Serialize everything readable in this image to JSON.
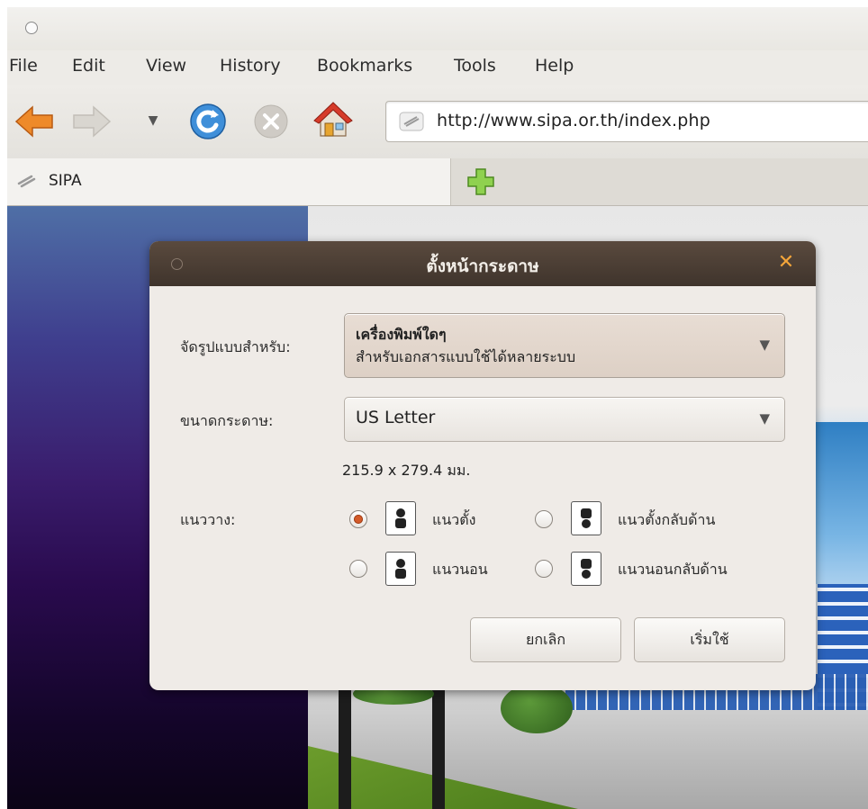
{
  "menubar": {
    "items": [
      "File",
      "Edit",
      "View",
      "History",
      "Bookmarks",
      "Tools",
      "Help"
    ]
  },
  "navbar": {
    "url": "http://www.sipa.or.th/index.php"
  },
  "tabs": [
    {
      "label": "SIPA"
    }
  ],
  "dialog": {
    "title": "ตั้งหน้ากระดาษ",
    "format_for_label": "จัดรูปแบบสำหรับ:",
    "printer_name": "เครื่องพิมพ์ใดๆ",
    "printer_desc": "สำหรับเอกสารแบบใช้ได้หลายระบบ",
    "paper_size_label": "ขนาดกระดาษ:",
    "paper_size_value": "US Letter",
    "paper_dims": "215.9 x 279.4 มม.",
    "orientation_label": "แนววาง:",
    "orientations": [
      {
        "label": "แนวตั้ง",
        "selected": true
      },
      {
        "label": "แนวตั้งกลับด้าน",
        "selected": false
      },
      {
        "label": "แนวนอน",
        "selected": false
      },
      {
        "label": "แนวนอนกลับด้าน",
        "selected": false
      }
    ],
    "cancel_label": "ยกเลิก",
    "apply_label": "เริ่มใช้"
  },
  "colors": {
    "dialog_title_bg": "#4a3d33",
    "radio_selected": "#d45b2a",
    "close_icon": "#f3a53a"
  }
}
